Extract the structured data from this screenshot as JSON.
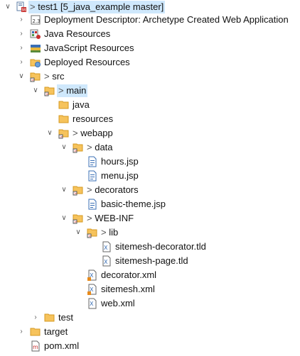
{
  "colors": {
    "selection": "#cfe8fc",
    "folder": "#f6c35c",
    "folder_dark": "#d59a22",
    "jsp_blue": "#3a6fb5",
    "xml_orange": "#e88a1a"
  },
  "tree": {
    "project": {
      "prefix": ">",
      "label": "test1 [5_java_example master]"
    },
    "deployment_descriptor": {
      "label": "Deployment Descriptor: Archetype Created Web Application"
    },
    "java_resources": {
      "label": "Java Resources"
    },
    "javascript_resources": {
      "label": "JavaScript Resources"
    },
    "deployed_resources": {
      "label": "Deployed Resources"
    },
    "src": {
      "prefix": ">",
      "label": "src"
    },
    "main": {
      "prefix": ">",
      "label": "main"
    },
    "java": {
      "label": "java"
    },
    "resources": {
      "label": "resources"
    },
    "webapp": {
      "prefix": ">",
      "label": "webapp"
    },
    "data": {
      "prefix": ">",
      "label": "data"
    },
    "hours_jsp": {
      "label": "hours.jsp"
    },
    "menu_jsp": {
      "label": "menu.jsp"
    },
    "decorators": {
      "prefix": ">",
      "label": "decorators"
    },
    "basic_theme_jsp": {
      "label": "basic-theme.jsp"
    },
    "web_inf": {
      "prefix": ">",
      "label": "WEB-INF"
    },
    "lib": {
      "prefix": ">",
      "label": "lib"
    },
    "sitemesh_decorator_tld": {
      "label": "sitemesh-decorator.tld"
    },
    "sitemesh_page_tld": {
      "label": "sitemesh-page.tld"
    },
    "decorator_xml": {
      "label": "decorator.xml"
    },
    "sitemesh_xml": {
      "label": "sitemesh.xml"
    },
    "web_xml": {
      "label": "web.xml"
    },
    "test": {
      "label": "test"
    },
    "target": {
      "label": "target"
    },
    "pom_xml": {
      "label": "pom.xml"
    }
  }
}
